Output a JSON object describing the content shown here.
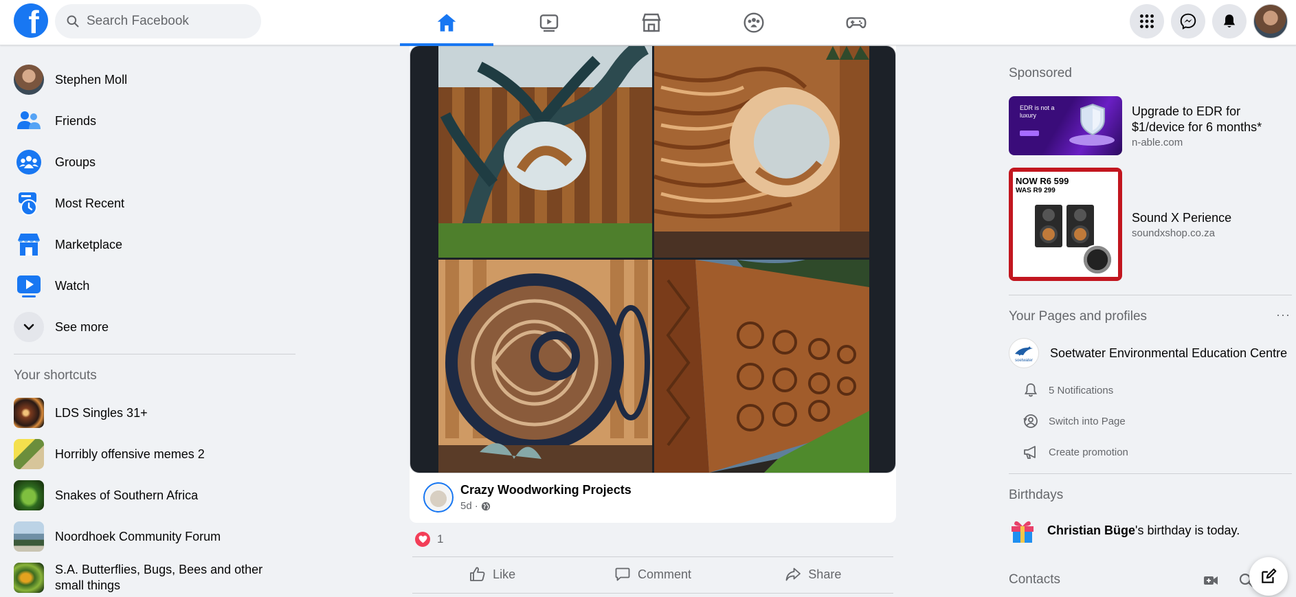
{
  "search": {
    "placeholder": "Search Facebook"
  },
  "nav_tabs": [
    "home-icon",
    "watch-icon",
    "marketplace-icon",
    "groups-icon",
    "gaming-icon"
  ],
  "accent": "#1877f2",
  "left_menu": {
    "items": [
      {
        "label": "Stephen Moll",
        "icon": "avatar"
      },
      {
        "label": "Friends",
        "icon": "friends-icon"
      },
      {
        "label": "Groups",
        "icon": "groups-icon"
      },
      {
        "label": "Most Recent",
        "icon": "most-recent-icon"
      },
      {
        "label": "Marketplace",
        "icon": "marketplace-icon"
      },
      {
        "label": "Watch",
        "icon": "watch-icon"
      },
      {
        "label": "See more",
        "icon": "chevron-down-icon"
      }
    ],
    "shortcuts_title": "Your shortcuts",
    "shortcuts": [
      {
        "label": "LDS Singles 31+"
      },
      {
        "label": "Horribly offensive memes 2"
      },
      {
        "label": "Snakes of Southern Africa"
      },
      {
        "label": "Noordhoek Community Forum"
      },
      {
        "label": "S.A. Butterflies, Bugs, Bees and other small things"
      }
    ]
  },
  "post": {
    "page_name": "Crazy Woodworking Projects",
    "time": "5d",
    "reaction_count": "1",
    "actions": {
      "like": "Like",
      "comment": "Comment",
      "share": "Share"
    }
  },
  "right": {
    "sponsored_title": "Sponsored",
    "ads": [
      {
        "title": "Upgrade to EDR for $1/device for 6 months*",
        "domain": "n-able.com",
        "thumb_text": "EDR is not a luxury"
      },
      {
        "title": "Sound X Perience",
        "domain": "soundxshop.co.za",
        "thumb_now": "NOW R6 599",
        "thumb_was": "WAS R9 299"
      }
    ],
    "pages_title": "Your Pages and profiles",
    "page": {
      "name": "Soetwater Environmental Education Centre",
      "logo_text": "soetwater",
      "subitems": [
        "5 Notifications",
        "Switch into Page",
        "Create promotion"
      ]
    },
    "birthdays_title": "Birthdays",
    "birthday": {
      "name": "Christian Büge",
      "suffix": "'s birthday is today."
    },
    "contacts_title": "Contacts"
  }
}
